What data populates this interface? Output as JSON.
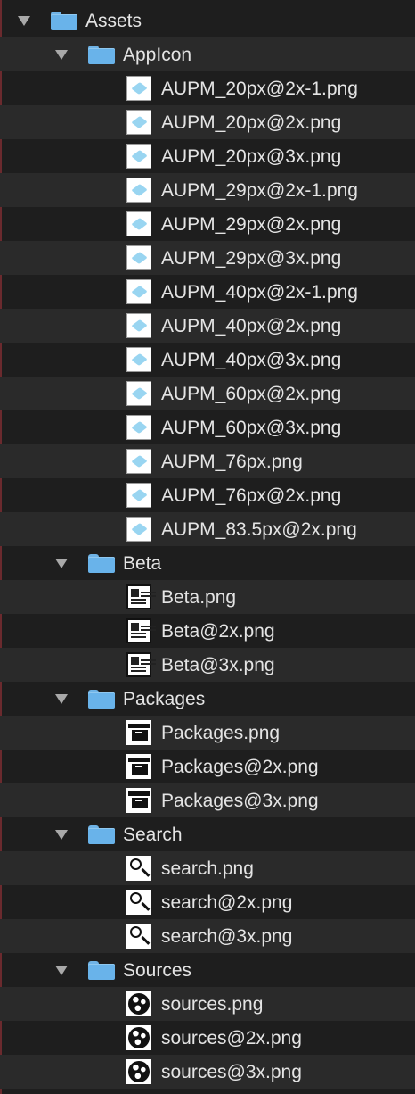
{
  "tree": {
    "root": {
      "label": "Assets",
      "icon": "folder-icon",
      "expanded": true
    },
    "groups": [
      {
        "label": "AppIcon",
        "icon": "folder-icon",
        "file_icon": "appicon-image-icon",
        "files": [
          "AUPM_20px@2x-1.png",
          "AUPM_20px@2x.png",
          "AUPM_20px@3x.png",
          "AUPM_29px@2x-1.png",
          "AUPM_29px@2x.png",
          "AUPM_29px@3x.png",
          "AUPM_40px@2x-1.png",
          "AUPM_40px@2x.png",
          "AUPM_40px@3x.png",
          "AUPM_60px@2x.png",
          "AUPM_60px@3x.png",
          "AUPM_76px.png",
          "AUPM_76px@2x.png",
          "AUPM_83.5px@2x.png"
        ]
      },
      {
        "label": "Beta",
        "icon": "folder-icon",
        "file_icon": "newspaper-icon",
        "files": [
          "Beta.png",
          "Beta@2x.png",
          "Beta@3x.png"
        ]
      },
      {
        "label": "Packages",
        "icon": "folder-icon",
        "file_icon": "archive-box-icon",
        "files": [
          "Packages.png",
          "Packages@2x.png",
          "Packages@3x.png"
        ]
      },
      {
        "label": "Search",
        "icon": "folder-icon",
        "file_icon": "magnifier-icon",
        "files": [
          "search.png",
          "search@2x.png",
          "search@3x.png"
        ]
      },
      {
        "label": "Sources",
        "icon": "folder-icon",
        "file_icon": "globe-icon",
        "files": [
          "sources.png",
          "sources@2x.png",
          "sources@3x.png"
        ]
      }
    ]
  },
  "colors": {
    "background": "#1e1e1e",
    "row_alt": "#2a2a2a",
    "folder": "#69b3ea",
    "text": "#e4e4e4",
    "disclosure": "#a9a9a9"
  }
}
